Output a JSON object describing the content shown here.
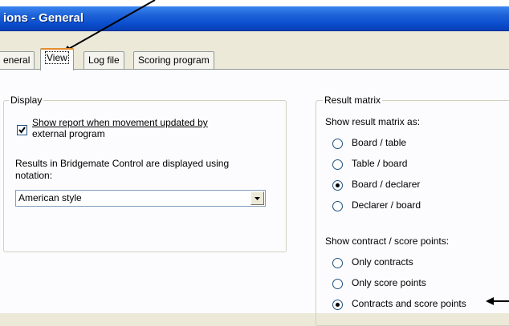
{
  "window": {
    "title": "ions - General"
  },
  "tabs": [
    {
      "label": "eneral",
      "active": false
    },
    {
      "label": "View",
      "active": true
    },
    {
      "label": "Log file",
      "active": false
    },
    {
      "label": "Scoring program",
      "active": false
    }
  ],
  "display_group": {
    "title": "Display",
    "show_report": {
      "line1": "Show report when movement updated by",
      "line2": "external program",
      "checked": true
    },
    "notation_label_line1": "Results in Bridgemate Control are displayed using",
    "notation_label_line2": "notation:",
    "notation_select_value": "American style"
  },
  "result_group": {
    "title": "Result matrix",
    "show_as_label": "Show result matrix as:",
    "matrix_options": [
      {
        "label": "Board / table",
        "checked": false
      },
      {
        "label": "Table / board",
        "checked": false
      },
      {
        "label": "Board / declarer",
        "checked": true
      },
      {
        "label": "Declarer / board",
        "checked": false
      }
    ],
    "contract_label": "Show contract / score points:",
    "contract_options": [
      {
        "label": "Only contracts",
        "checked": false
      },
      {
        "label": "Only score points",
        "checked": false
      },
      {
        "label": "Contracts and score points",
        "checked": true
      }
    ]
  },
  "colors": {
    "titlebar": "#0b4fd0",
    "active_tab_accent": "#e68b2c",
    "radio_dot": "#000000"
  }
}
